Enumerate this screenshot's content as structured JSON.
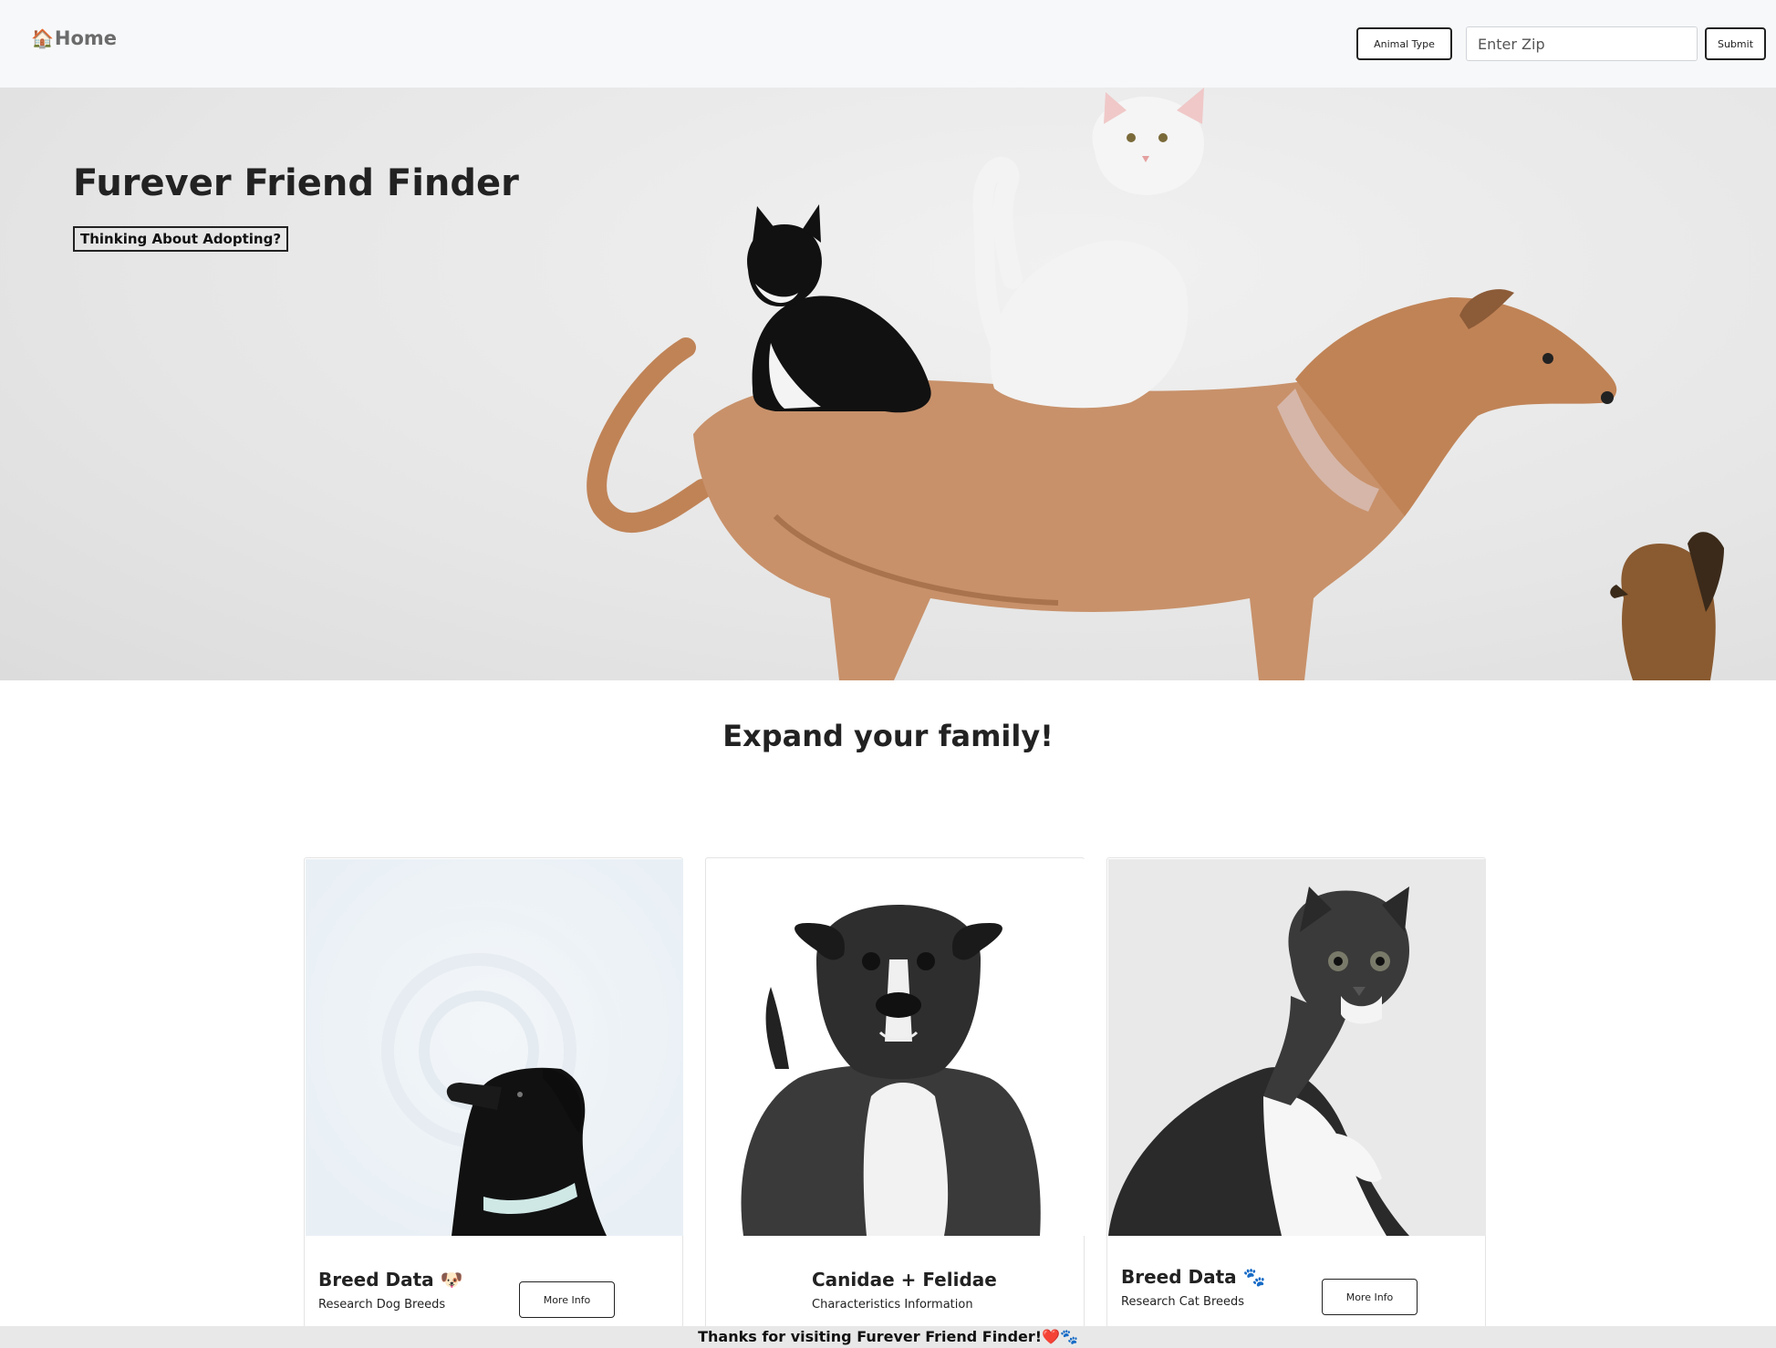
{
  "nav": {
    "brand_label": "Home",
    "animal_type_label": "Animal Type",
    "zip_placeholder": "Enter Zip",
    "submit_label": "Submit"
  },
  "hero": {
    "title": "Furever Friend Finder",
    "badge": "Thinking About Adopting?"
  },
  "section": {
    "title": "Expand your family!"
  },
  "cards": [
    {
      "title": "Breed Data 🐶",
      "subtitle": "Research Dog Breeds",
      "button": "More Info"
    },
    {
      "title": "Canidae + Felidae",
      "subtitle": "Characteristics Information"
    },
    {
      "title": "Breed Data 🐾",
      "subtitle": "Research Cat Breeds",
      "button": "More Info"
    }
  ],
  "footer": {
    "text": "Thanks for visiting Furever Friend Finder!❤️🐾"
  }
}
